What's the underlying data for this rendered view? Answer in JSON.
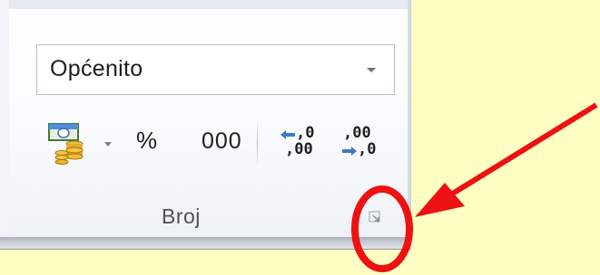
{
  "number_group": {
    "label": "Broj",
    "format_dropdown": {
      "value": "Općenito"
    },
    "buttons": {
      "percent_label": "%",
      "comma_label": "000",
      "increase_decimal": {
        "top": ",0",
        "bottom": ",00"
      },
      "decrease_decimal": {
        "top": ",00",
        "bottom": ",0"
      }
    }
  },
  "icons": {
    "accounting": "accounting-format-icon",
    "increase_decimal": "increase-decimal-icon",
    "decrease_decimal": "decrease-decimal-icon",
    "launcher": "dialog-launcher-icon",
    "annotation": "red-arrow-and-circle"
  },
  "colors": {
    "background": "#ffffc4",
    "annotation": "#ee1111",
    "panel": "#f7f9fc"
  }
}
